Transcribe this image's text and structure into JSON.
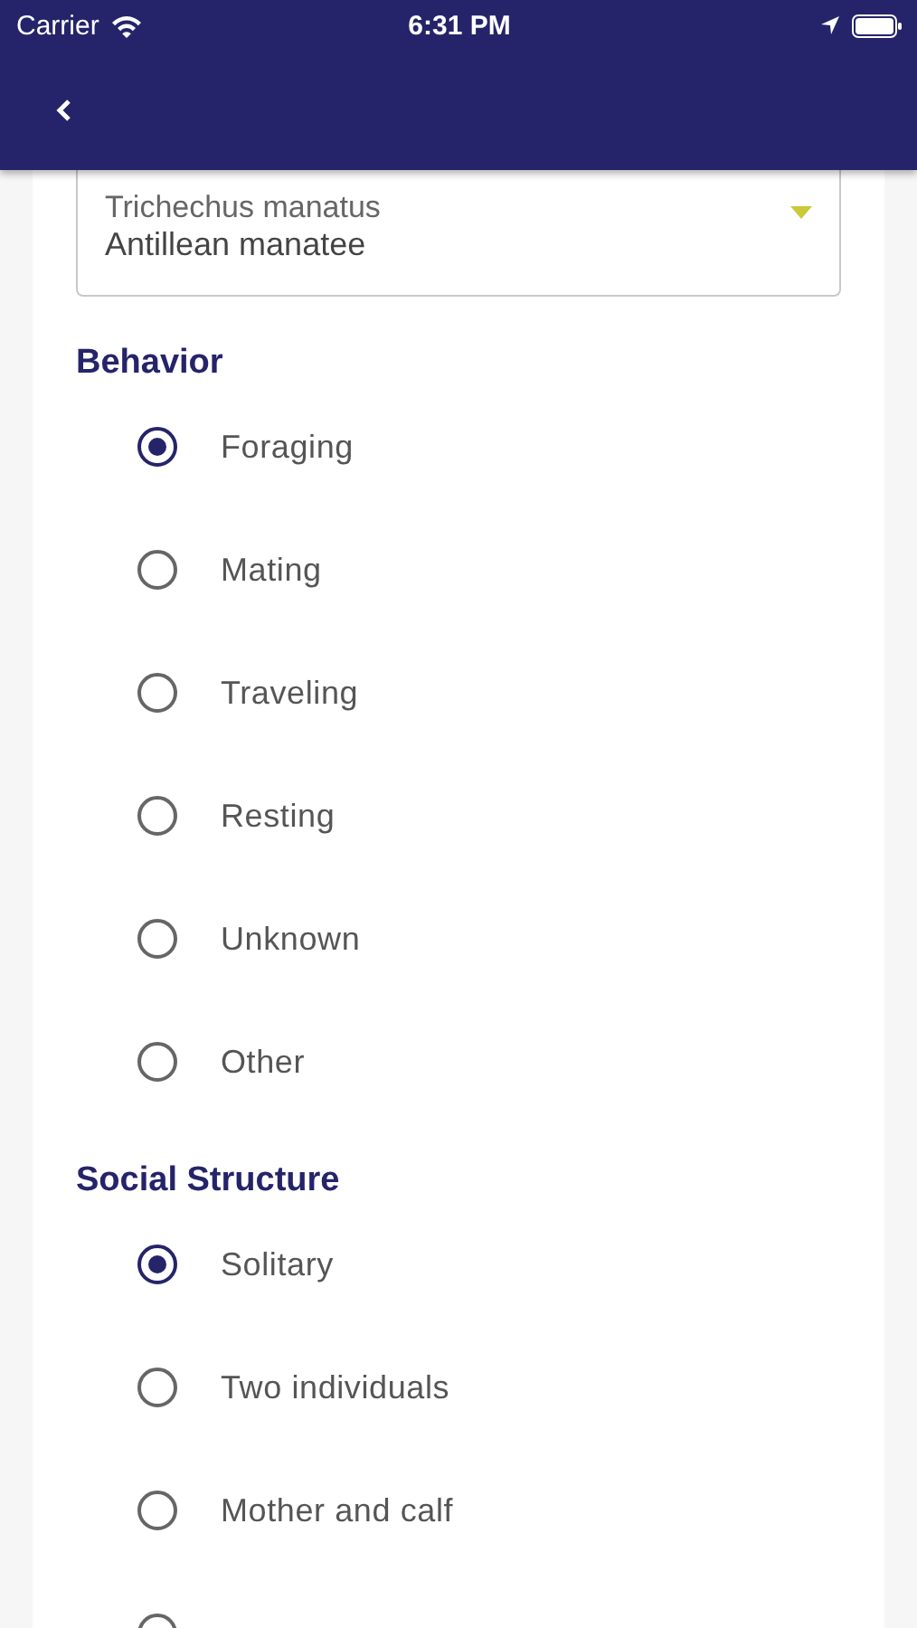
{
  "status_bar": {
    "carrier": "Carrier",
    "time": "6:31 PM"
  },
  "species_dropdown": {
    "scientific_name": "Trichechus manatus",
    "common_name": "Antillean manatee"
  },
  "sections": [
    {
      "title": "Behavior",
      "options": [
        {
          "label": "Foraging",
          "selected": true
        },
        {
          "label": "Mating",
          "selected": false
        },
        {
          "label": "Traveling",
          "selected": false
        },
        {
          "label": "Resting",
          "selected": false
        },
        {
          "label": "Unknown",
          "selected": false
        },
        {
          "label": "Other",
          "selected": false
        }
      ]
    },
    {
      "title": "Social Structure",
      "options": [
        {
          "label": "Solitary",
          "selected": true
        },
        {
          "label": "Two individuals",
          "selected": false
        },
        {
          "label": "Mother and calf",
          "selected": false
        },
        {
          "selected": false
        }
      ]
    }
  ]
}
